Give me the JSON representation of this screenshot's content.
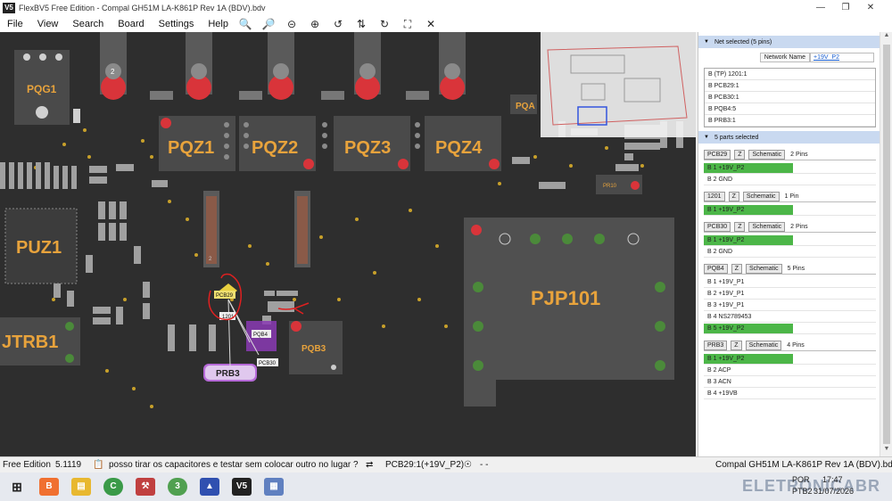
{
  "window": {
    "title": "FlexBV5 Free Edition - Compal GH51M LA-K861P Rev 1A (BDV).bdv",
    "logo": "V5"
  },
  "menu": [
    "File",
    "View",
    "Search",
    "Board",
    "Settings",
    "Help"
  ],
  "toolbar_icons": [
    "zoom-in-icon",
    "zoom-out-icon",
    "zoom-minus-circle-icon",
    "zoom-plus-circle-icon",
    "rotate-ccw-icon",
    "flip-icon",
    "rotate-cw-icon",
    "fit-icon",
    "close-x-icon"
  ],
  "board": {
    "labels": {
      "pqg1": "PQG1",
      "pqz1": "PQZ1",
      "pqz2": "PQZ2",
      "pqz3": "PQZ3",
      "pqz4": "PQZ4",
      "puz1": "PUZ1",
      "pjp101": "PJP101",
      "jtrb1": "JTRB1",
      "pqb3": "PQB3",
      "prb3": "PRB3",
      "pqa": "PQA"
    },
    "pin_tags": {
      "pcb29": "PCB29",
      "r1201": "1201",
      "pqb4": "PQB4",
      "pcb30": "PCB30",
      "pr10": "PR10"
    },
    "pin_num": "2"
  },
  "panel": {
    "net_selected_header": "Net selected (5 pins)",
    "network_name_label": "Network Name",
    "network_name_value": "+19V_P2",
    "net_items": [
      "B (TP) 1201:1",
      "B PCB29:1",
      "B PCB30:1",
      "B PQB4:5",
      "B PRB3:1"
    ],
    "parts_selected_header": "5 parts selected",
    "parts": [
      {
        "name": "PCB29",
        "z": "Z",
        "schematic": "Schematic",
        "pins": "2 Pins",
        "rows": [
          {
            "text": "B  1  +19V_P2",
            "hl": true
          },
          {
            "text": "B  2  GND",
            "hl": false
          }
        ]
      },
      {
        "name": "1201",
        "z": "Z",
        "schematic": "Schematic",
        "pins": "1 Pin",
        "rows": [
          {
            "text": "B  1  +19V_P2",
            "hl": true
          }
        ]
      },
      {
        "name": "PCB30",
        "z": "Z",
        "schematic": "Schematic",
        "pins": "2 Pins",
        "rows": [
          {
            "text": "B  1  +19V_P2",
            "hl": true
          },
          {
            "text": "B  2  GND",
            "hl": false
          }
        ]
      },
      {
        "name": "PQB4",
        "z": "Z",
        "schematic": "Schematic",
        "pins": "5 Pins",
        "rows": [
          {
            "text": "B  1  +19V_P1",
            "hl": false
          },
          {
            "text": "B  2  +19V_P1",
            "hl": false
          },
          {
            "text": "B  3  +19V_P1",
            "hl": false
          },
          {
            "text": "B  4  NS2789453",
            "hl": false
          },
          {
            "text": "B  5  +19V_P2",
            "hl": true
          }
        ]
      },
      {
        "name": "PRB3",
        "z": "Z",
        "schematic": "Schematic",
        "pins": "4 Pins",
        "rows": [
          {
            "text": "B  1  +19V_P2",
            "hl": true
          },
          {
            "text": "B  2  ACP",
            "hl": false
          },
          {
            "text": "B  3  ACN",
            "hl": false
          },
          {
            "text": "B  4  +19VB",
            "hl": false
          }
        ]
      }
    ]
  },
  "status": {
    "edition": "Free Edition",
    "version": "5.1119",
    "message": "posso tirar os capacitores e testar sem colocar outro no lugar ?",
    "pin_info": "PCB29:1(+19V_P2)",
    "extra": "- -",
    "file": "Compal GH51M LA-K861P Rev 1A (BDV).bdv"
  },
  "taskbar": {
    "lang": "POR",
    "lang2": "PTB2",
    "time": "17:47",
    "date": "31/07/2026",
    "watermark": "ELETRONICABR"
  },
  "colors": {
    "board_bg": "#2e2e2e",
    "component": "#4a4a4a",
    "label": "#e8a33c",
    "pad_red": "#d9343a",
    "pad_green": "#4b8a3a",
    "pad_white": "#d0d0d0",
    "highlight": "#4cb648",
    "panel_head": "#c9d9f0"
  }
}
